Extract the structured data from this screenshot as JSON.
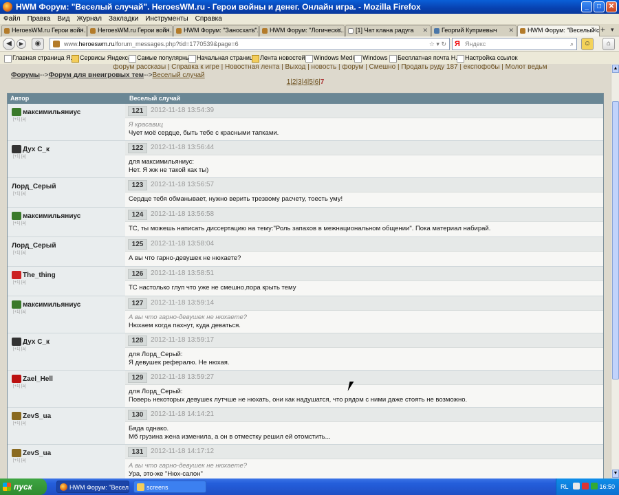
{
  "window": {
    "title": "HWM Форум: \"Веселый случай\". HeroesWM.ru - Герои войны и денег. Онлайн игра. - Mozilla Firefox",
    "buttons": {
      "minimize": "_",
      "maximize": "□",
      "close": "✕"
    }
  },
  "menu": [
    "Файл",
    "Правка",
    "Вид",
    "Журнал",
    "Закладки",
    "Инструменты",
    "Справка"
  ],
  "tabs": [
    {
      "label": "HeroesWM.ru Герои войн...",
      "active": false
    },
    {
      "label": "HeroesWM.ru Герои войн...",
      "active": false
    },
    {
      "label": "HWM Форум: \"Заносхать\"...",
      "active": false
    },
    {
      "label": "HWM Форум: \"Логическо...",
      "active": false
    },
    {
      "label": "[1] Чат клана радуга",
      "active": false
    },
    {
      "label": "Георгий Куприевыч",
      "active": false
    },
    {
      "label": "HWM Форум: \"Веселый с...",
      "active": true
    }
  ],
  "tab_plus": "+",
  "nav": {
    "url_prefix": "www.",
    "url_host": "heroeswm.ru",
    "url_path": "/forum_messages.php?tid=1770539&page=6",
    "search_placeholder": "Яндекс",
    "search_logo": "Я"
  },
  "bookmarks": [
    {
      "label": "Главная страница Я...",
      "folder": false
    },
    {
      "label": "Сервисы Яндекса",
      "folder": true
    },
    {
      "label": "Самые популярные",
      "folder": false
    },
    {
      "label": "Начальная страница",
      "folder": false
    },
    {
      "label": "Лента новостей",
      "folder": true
    },
    {
      "label": "Windows Media",
      "folder": false
    },
    {
      "label": "Windows",
      "folder": false
    },
    {
      "label": "Бесплатная почта H...",
      "folder": false
    },
    {
      "label": "Настройка ссылок",
      "folder": false
    }
  ],
  "page": {
    "top_links": "форум рассказы | Справка к игре | Новостная лента | Выход | новость | форум | Смешно | Продать руду 187 | експофобы | Молот ведьм",
    "breadcrumb": {
      "forums": "Форумы",
      "sep1": "-->",
      "section": "Форум для внеигровых тем",
      "sep2": "-->",
      "topic": "Веселый случай"
    },
    "pagination": [
      "1",
      "2",
      "3",
      "4",
      "5",
      "6",
      "7"
    ],
    "current_page": "7",
    "table_header": {
      "author": "Автор",
      "topic": "Веселый случай"
    }
  },
  "posts": [
    {
      "author": "максимильяниус",
      "icon_color": "#3a7a2a",
      "num": "121",
      "ts": "2012-11-18 13:54:39",
      "quote": "Я красавиц",
      "text": "Чует моё сердце, быть тебе с красными тапками."
    },
    {
      "author": "Дух С_к",
      "icon_color": "#333333",
      "num": "122",
      "ts": "2012-11-18 13:56:44",
      "quote": "",
      "text": "для максимильяниус:\nНет. Я жж не такой как ты)"
    },
    {
      "author": "Лорд_Серый",
      "icon_color": "",
      "num": "123",
      "ts": "2012-11-18 13:56:57",
      "quote": "",
      "text": "Сердце тебя обманывает, нужно верить трезвому расчету, тоесть уму!"
    },
    {
      "author": "максимильяниус",
      "icon_color": "#3a7a2a",
      "num": "124",
      "ts": "2012-11-18 13:56:58",
      "quote": "",
      "text": "ТС, ты можешь написать диссертацию на тему:\"Роль запахов в межнациональном общении\". Пока материал набирай."
    },
    {
      "author": "Лорд_Серый",
      "icon_color": "",
      "num": "125",
      "ts": "2012-11-18 13:58:04",
      "quote": "",
      "text": "А вы что гарно-девушек не нюхаете?"
    },
    {
      "author": "The_thing",
      "icon_color": "#cc2222",
      "num": "126",
      "ts": "2012-11-18 13:58:51",
      "quote": "",
      "text": "ТС настолько глуп что уже не смешно,пора крыть тему"
    },
    {
      "author": "максимильяниус",
      "icon_color": "#3a7a2a",
      "num": "127",
      "ts": "2012-11-18 13:59:14",
      "quote": "А вы что гарно-девушек не нюхаете?",
      "text": "Нюхаем когда пахнут, куда деваться."
    },
    {
      "author": "Дух С_к",
      "icon_color": "#333333",
      "num": "128",
      "ts": "2012-11-18 13:59:17",
      "quote": "",
      "text": "для Лорд_Серый:\nЯ девушек рефералю. Не нюхая."
    },
    {
      "author": "Zael_Hell",
      "icon_color": "#bb1111",
      "num": "129",
      "ts": "2012-11-18 13:59:27",
      "quote": "",
      "text": "для Лорд_Серый:\nПоверь некоторых девушек лутчше не нюхать, они как надушатся, что рядом с ними даже стоять не возможно."
    },
    {
      "author": "ZevS_ua",
      "icon_color": "#8a6a20",
      "num": "130",
      "ts": "2012-11-18 14:14:21",
      "quote": "",
      "text": "Бяда однако.\nМб грузина жена изменила, а он в отместку решил ей отомстить..."
    },
    {
      "author": "ZevS_ua",
      "icon_color": "#8a6a20",
      "num": "131",
      "ts": "2012-11-18 14:17:12",
      "quote": "А вы что гарно-девушек не нюхаете?",
      "text": "Ура, это-же \"Нюх-салон\""
    }
  ],
  "author_sub": "[+1] [a]",
  "taskbar": {
    "start": "пуск",
    "tasks": [
      {
        "label": "HWM Форум: \"Весел...",
        "active": true
      },
      {
        "label": "screens",
        "active": false
      }
    ],
    "lang": "RL",
    "clock": "16:50"
  }
}
